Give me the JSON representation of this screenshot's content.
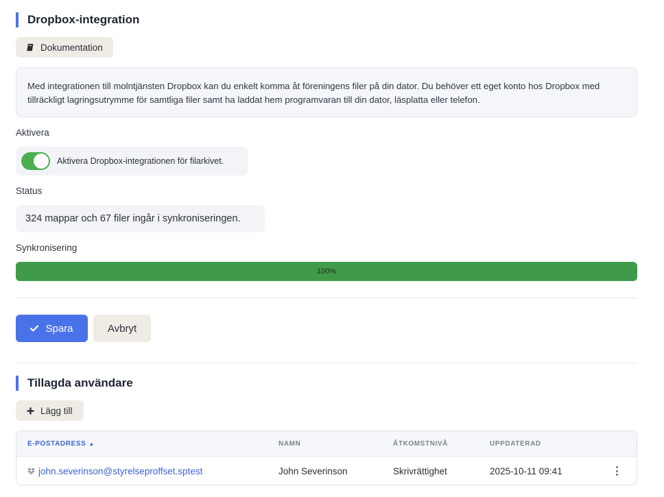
{
  "dropbox_section": {
    "title": "Dropbox-integration",
    "doc_button_label": "Dokumentation",
    "description": "Med integrationen till molntjänsten Dropbox kan du enkelt komma åt föreningens filer på din dator. Du behöver ett eget konto hos Dropbox med tillräckligt lagringsutrymme för samtliga filer samt ha laddat hem programvaran till din dator, läsplatta eller telefon.",
    "activate_label": "Aktivera",
    "toggle_text": "Aktivera Dropbox-integrationen för filarkivet.",
    "toggle_on": true,
    "status_label": "Status",
    "status_text": "324 mappar och 67 filer ingår i synkroniseringen.",
    "sync_label": "Synkronisering",
    "sync_progress_percent": 100,
    "sync_progress_text": "100%"
  },
  "actions": {
    "save_label": "Spara",
    "cancel_label": "Avbryt"
  },
  "users_section": {
    "title": "Tillagda användare",
    "add_button_label": "Lägg till",
    "columns": {
      "email": "E-POSTADRESS",
      "name": "NAMN",
      "access": "ÅTKOMSTNIVÅ",
      "updated": "UPPDATERAD"
    },
    "rows": [
      {
        "email": "john.severinson@styrelseproffset.sptest",
        "name": "John Severinson",
        "access": "Skrivrättighet",
        "updated": "2025-10-11 09:41"
      }
    ]
  },
  "icons": {
    "doc_button": "book-icon",
    "save_button": "check-icon",
    "add_button": "plus-icon",
    "email_row": "dropbox-icon",
    "row_menu": "more-vertical-icon",
    "sort": "sort-ascending-icon"
  },
  "colors": {
    "accent": "#4a72e8",
    "toggle_on": "#4caf50",
    "progress": "#3f9a4a",
    "link": "#3d63d4"
  }
}
